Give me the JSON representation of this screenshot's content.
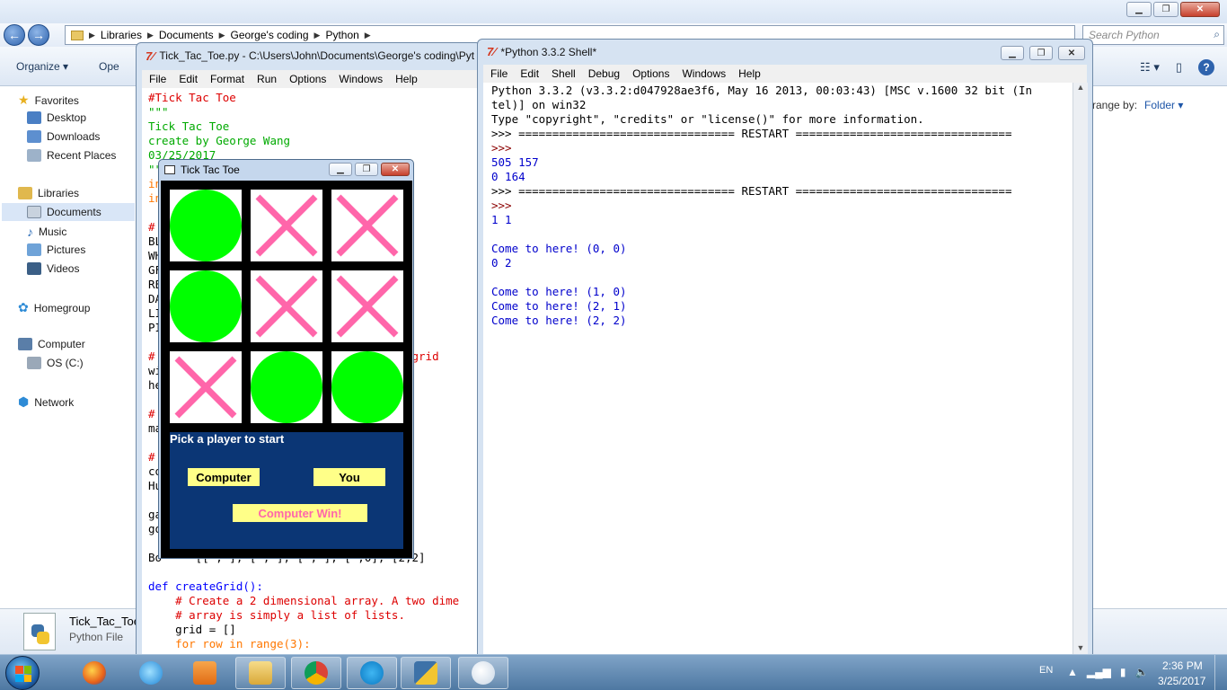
{
  "explorer": {
    "breadcrumbs": [
      "Libraries",
      "Documents",
      "George's coding",
      "Python"
    ],
    "search_placeholder": "Search Python",
    "organize_label": "Organize ▾",
    "open_label": "Ope",
    "arrange_label": "rrange by:",
    "arrange_value": "Folder ▾",
    "nav": {
      "favorites": "Favorites",
      "desktop": "Desktop",
      "downloads": "Downloads",
      "recent_places": "Recent Places",
      "libraries": "Libraries",
      "documents": "Documents",
      "music": "Music",
      "pictures": "Pictures",
      "videos": "Videos",
      "homegroup": "Homegroup",
      "computer": "Computer",
      "os_drive": "OS (C:)",
      "network": "Network"
    },
    "details": {
      "file_name": "Tick_Tac_Toe",
      "file_type": "Python File"
    }
  },
  "editor": {
    "title": "Tick_Tac_Toe.py - C:\\Users\\John\\Documents\\George's coding\\Pyt",
    "menu": [
      "File",
      "Edit",
      "Format",
      "Run",
      "Options",
      "Windows",
      "Help"
    ],
    "lines": [
      {
        "cls": "c-comment",
        "text": "#Tick Tac Toe"
      },
      {
        "cls": "c-string",
        "text": "\"\"\""
      },
      {
        "cls": "c-string",
        "text": "Tick Tac Toe"
      },
      {
        "cls": "c-string",
        "text": "create by George Wang"
      },
      {
        "cls": "c-string",
        "text": "03/25/2017"
      },
      {
        "cls": "c-string",
        "text": "\"\""
      },
      {
        "cls": "c-kw",
        "text": "in"
      },
      {
        "cls": "c-kw",
        "text": "in"
      },
      {
        "cls": "c-plain",
        "text": ""
      },
      {
        "cls": "c-comment",
        "text": "#"
      },
      {
        "cls": "c-plain",
        "text": "BL"
      },
      {
        "cls": "c-plain",
        "text": "WH"
      },
      {
        "cls": "c-plain",
        "text": "GF"
      },
      {
        "cls": "c-plain",
        "text": "RE"
      },
      {
        "cls": "c-plain",
        "text": "DA"
      },
      {
        "cls": "c-plain",
        "text": "LI"
      },
      {
        "cls": "c-plain",
        "text": "PI"
      },
      {
        "cls": "c-plain",
        "text": ""
      },
      {
        "cls": "c-comment",
        "text": "#                                  ach grid"
      },
      {
        "cls": "c-plain",
        "text": "wi"
      },
      {
        "cls": "c-plain",
        "text": "he"
      },
      {
        "cls": "c-plain",
        "text": ""
      },
      {
        "cls": "c-comment",
        "text": "#                                  ell"
      },
      {
        "cls": "c-plain",
        "text": "ma"
      },
      {
        "cls": "c-plain",
        "text": ""
      },
      {
        "cls": "c-comment",
        "text": "#"
      },
      {
        "cls": "c-plain",
        "text": "co"
      },
      {
        "cls": "c-plain",
        "text": "Hu"
      },
      {
        "cls": "c-plain",
        "text": ""
      },
      {
        "cls": "c-plain",
        "text": "ga"
      },
      {
        "cls": "c-plain",
        "text": "go"
      },
      {
        "cls": "c-plain",
        "text": ""
      },
      {
        "cls": "c-plain",
        "text": "Bo     [[ , ], [ , ], [ , ], [ ,0], [2,2]"
      },
      {
        "cls": "c-plain",
        "text": ""
      },
      {
        "cls": "c-def",
        "text": "def createGrid():"
      },
      {
        "cls": "c-comment",
        "text": "    # Create a 2 dimensional array. A two dime"
      },
      {
        "cls": "c-comment",
        "text": "    # array is simply a list of lists."
      },
      {
        "cls": "c-plain",
        "text": "    grid = []"
      },
      {
        "cls": "c-kw",
        "text": "    for row in range(3):"
      }
    ]
  },
  "shell": {
    "title": "*Python 3.3.2 Shell*",
    "menu": [
      "File",
      "Edit",
      "Shell",
      "Debug",
      "Options",
      "Windows",
      "Help"
    ],
    "lines": [
      {
        "cls": "o-black",
        "text": "Python 3.3.2 (v3.3.2:d047928ae3f6, May 16 2013, 00:03:43) [MSC v.1600 32 bit (In"
      },
      {
        "cls": "o-black",
        "text": "tel)] on win32"
      },
      {
        "cls": "o-black",
        "text": "Type \"copyright\", \"credits\" or \"license()\" for more information."
      },
      {
        "cls": "o-black",
        "text": ">>> ================================ RESTART ================================"
      },
      {
        "cls": "o-prompt",
        "text": ">>>"
      },
      {
        "cls": "o-blue",
        "text": "505 157"
      },
      {
        "cls": "o-blue",
        "text": "0 164"
      },
      {
        "cls": "o-black",
        "text": ">>> ================================ RESTART ================================"
      },
      {
        "cls": "o-prompt",
        "text": ">>>"
      },
      {
        "cls": "o-blue",
        "text": "1 1"
      },
      {
        "cls": "o-blue",
        "text": ""
      },
      {
        "cls": "o-blue",
        "text": "Come to here! (0, 0)"
      },
      {
        "cls": "o-blue",
        "text": "0 2"
      },
      {
        "cls": "o-blue",
        "text": ""
      },
      {
        "cls": "o-blue",
        "text": "Come to here! (1, 0)"
      },
      {
        "cls": "o-blue",
        "text": "Come to here! (2, 1)"
      },
      {
        "cls": "o-blue",
        "text": "Come to here! (2, 2)"
      }
    ]
  },
  "game": {
    "title": "Tick Tac Toe",
    "board": [
      [
        "O",
        "X",
        "X"
      ],
      [
        "O",
        "X",
        "X"
      ],
      [
        "X",
        "O",
        "O"
      ]
    ],
    "prompt": "Pick a player to start",
    "computer_label": "Computer",
    "you_label": "You",
    "result": "Computer Win!",
    "colors": {
      "circle": "#00ff00",
      "cross": "#ff66aa",
      "panel": "#0b3675",
      "button": "#ffff88"
    }
  },
  "taskbar": {
    "apps": [
      "internet-explorer-icon",
      "firefox-icon",
      "media-player-icon",
      "explorer-icon",
      "chrome-icon",
      "skype-icon",
      "python-icon",
      "paint-icon"
    ],
    "language": "EN",
    "time": "2:36 PM",
    "date": "3/25/2017"
  }
}
